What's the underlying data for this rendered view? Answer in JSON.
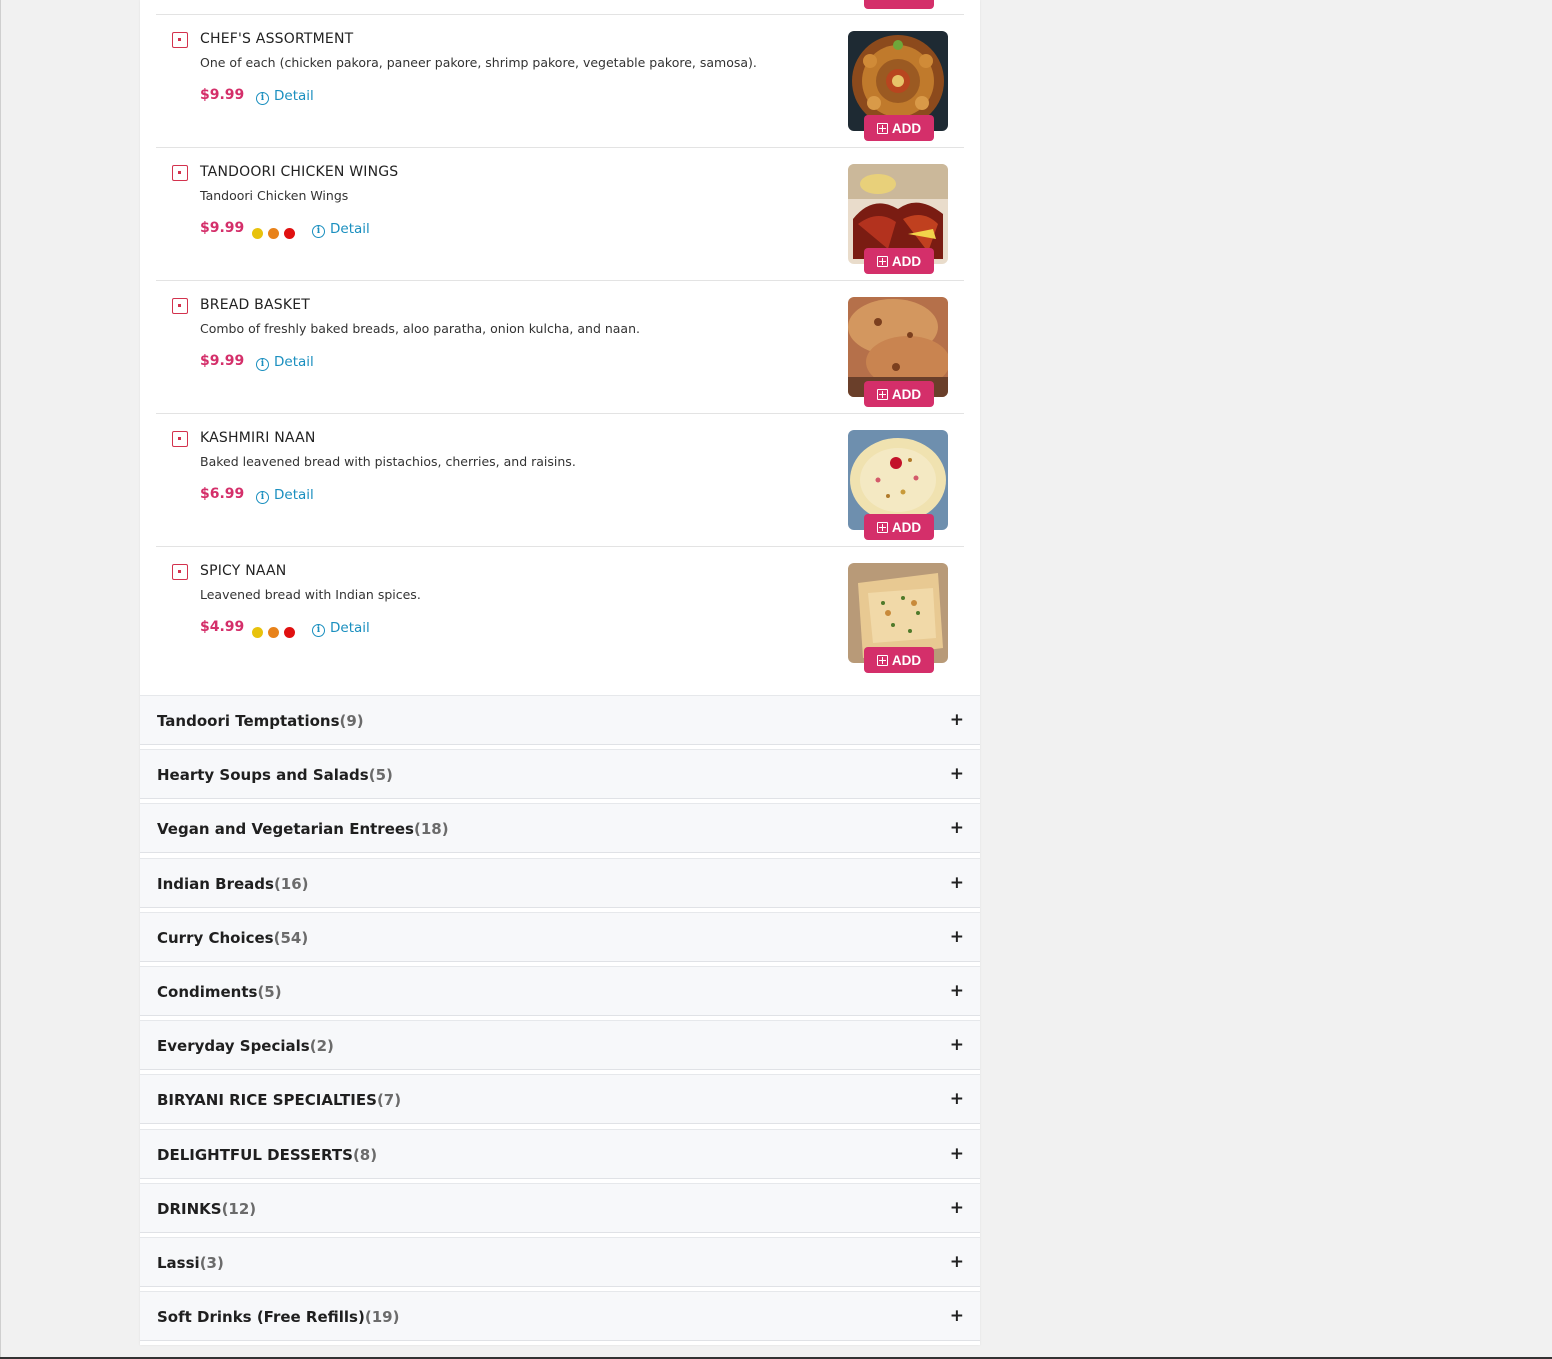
{
  "items": [
    {
      "name": "CHEF'S ASSORTMENT",
      "description": "One of each (chicken pakora, paneer pakore, shrimp pakore, vegetable pakore, samosa).",
      "price": "$9.99",
      "spice_level": 0,
      "detail_label": "Detail",
      "add_label": "ADD",
      "image": "platter-of-fried-appetizers"
    },
    {
      "name": "TANDOORI CHICKEN WINGS",
      "description": "Tandoori Chicken Wings",
      "price": "$9.99",
      "spice_level": 3,
      "detail_label": "Detail",
      "add_label": "ADD",
      "image": "tandoori-chicken-wings"
    },
    {
      "name": "BREAD BASKET",
      "description": "Combo of freshly baked breads, aloo paratha, onion kulcha, and naan.",
      "price": "$9.99",
      "spice_level": 0,
      "detail_label": "Detail",
      "add_label": "ADD",
      "image": "bread-basket"
    },
    {
      "name": "KASHMIRI NAAN",
      "description": "Baked leavened bread with pistachios, cherries, and raisins.",
      "price": "$6.99",
      "spice_level": 0,
      "detail_label": "Detail",
      "add_label": "ADD",
      "image": "kashmiri-naan"
    },
    {
      "name": "SPICY NAAN",
      "description": "Leavened bread with Indian spices.",
      "price": "$4.99",
      "spice_level": 3,
      "detail_label": "Detail",
      "add_label": "ADD",
      "image": "spicy-naan"
    }
  ],
  "categories": [
    {
      "name": "Tandoori Temptations",
      "count": "(9)"
    },
    {
      "name": "Hearty Soups and Salads",
      "count": "(5)"
    },
    {
      "name": "Vegan and Vegetarian Entrees",
      "count": "(18)"
    },
    {
      "name": "Indian Breads",
      "count": "(16)"
    },
    {
      "name": "Curry Choices",
      "count": "(54)"
    },
    {
      "name": "Condiments",
      "count": "(5)"
    },
    {
      "name": "Everyday Specials",
      "count": "(2)"
    },
    {
      "name": "BIRYANI RICE SPECIALTIES",
      "count": "(7)"
    },
    {
      "name": "DELIGHTFUL DESSERTS",
      "count": "(8)"
    },
    {
      "name": "DRINKS",
      "count": "(12)"
    },
    {
      "name": "Lassi",
      "count": "(3)"
    },
    {
      "name": "Soft Drinks (Free Refills)",
      "count": "(19)"
    }
  ],
  "expand_symbol": "+",
  "colors": {
    "accent": "#d42f6a",
    "link": "#1a8fbf",
    "veg_indicator": "#d3324d",
    "spice_mild": "#e8c20c",
    "spice_medium": "#e8821a",
    "spice_hot": "#e01010"
  }
}
